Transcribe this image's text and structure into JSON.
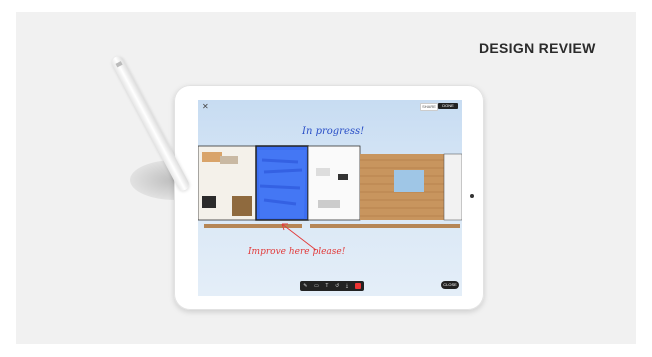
{
  "headline": "DESIGN REVIEW",
  "annotations": {
    "in_progress": "In progress!",
    "improve_here": "Improve here please!"
  },
  "toolbar": {
    "close_icon": "close-icon",
    "button_a": "SHARE",
    "button_b": "DONE"
  },
  "bottom_bar": {
    "tools": [
      "pen-icon",
      "shape-icon",
      "text-icon",
      "undo-icon",
      "download-icon",
      "record-icon"
    ]
  },
  "pill_label": "CLOSE",
  "colors": {
    "annotation_blue": "#2a4fc7",
    "annotation_red": "#e23a3a",
    "highlight_fill": "#3b6ef2"
  }
}
